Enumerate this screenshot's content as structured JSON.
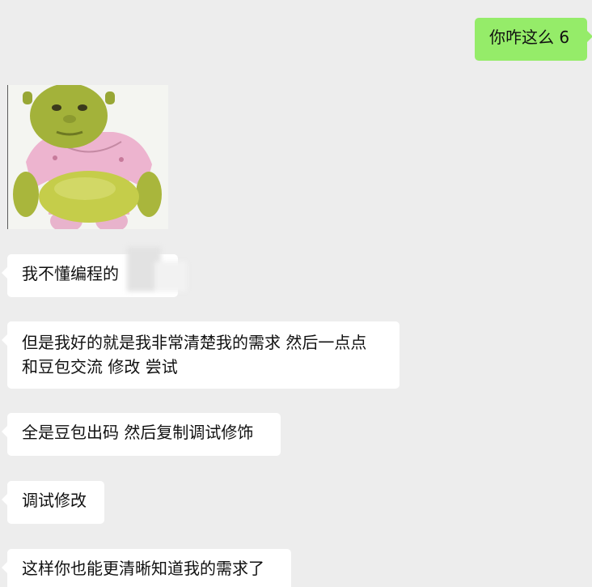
{
  "messages": [
    {
      "side": "right",
      "text": "你咋这么 6"
    },
    {
      "side": "left",
      "type": "sticker",
      "icon": "shrek-sticker"
    },
    {
      "side": "left",
      "text": "我不懂编程的"
    },
    {
      "side": "left",
      "lines": [
        "但是我好的就是我非常清楚我的需求 然后一点点",
        "和豆包交流 修改 尝试"
      ]
    },
    {
      "side": "left",
      "text": "全是豆包出码 然后复制调试修饰"
    },
    {
      "side": "left",
      "text": "调试修改"
    },
    {
      "side": "left",
      "text": "这样你也能更清晰知道我的需求了"
    }
  ],
  "colors": {
    "background": "#ededed",
    "incoming_bubble": "#ffffff",
    "outgoing_bubble": "#95ec69"
  }
}
